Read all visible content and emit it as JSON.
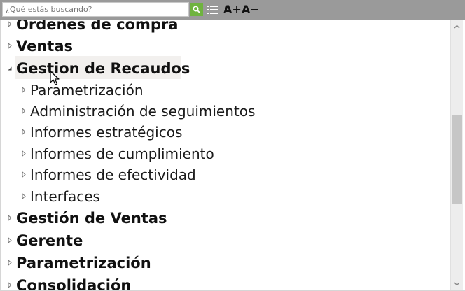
{
  "search": {
    "placeholder": "¿Qué estás buscando?"
  },
  "toolbar": {
    "increase_font_label": "A+",
    "decrease_font_label": "A−",
    "colors": {
      "bar": "#9a9a9a",
      "search_button": "#6fb33f"
    }
  },
  "tree": {
    "items": [
      {
        "label": "Órdenes de compra",
        "level": 1,
        "state": "collapsed"
      },
      {
        "label": "Ventas",
        "level": 1,
        "state": "collapsed"
      },
      {
        "label": "Gestion de Recaudos",
        "level": 1,
        "state": "expanded"
      },
      {
        "label": "Parametrización",
        "level": 2,
        "state": "collapsed"
      },
      {
        "label": "Administración de seguimientos",
        "level": 2,
        "state": "collapsed"
      },
      {
        "label": "Informes estratégicos",
        "level": 2,
        "state": "collapsed"
      },
      {
        "label": "Informes de cumplimiento",
        "level": 2,
        "state": "collapsed"
      },
      {
        "label": "Informes de efectividad",
        "level": 2,
        "state": "collapsed"
      },
      {
        "label": "Interfaces",
        "level": 2,
        "state": "collapsed"
      },
      {
        "label": "Gestión de Ventas",
        "level": 1,
        "state": "collapsed"
      },
      {
        "label": "Gerente",
        "level": 1,
        "state": "collapsed"
      },
      {
        "label": "Parametrización",
        "level": 1,
        "state": "collapsed"
      },
      {
        "label": "Consolidación",
        "level": 1,
        "state": "collapsed"
      }
    ]
  }
}
